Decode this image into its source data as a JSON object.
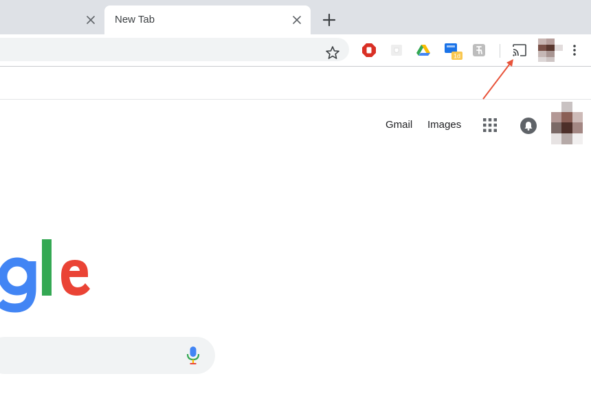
{
  "browser": {
    "active_tab": {
      "title": "New Tab"
    },
    "colors": {
      "tabstrip": "#dee1e6",
      "omnibox": "#f1f3f4",
      "annotation_arrow": "#e8533a"
    }
  },
  "toolbar": {
    "icons": [
      "bookmark-star-icon",
      "adblock-icon",
      "shield-extension-icon",
      "google-drive-icon",
      "extension-badge-icon",
      "extension-grey-icon",
      "cast-icon",
      "profile-avatar",
      "more-vert-icon"
    ],
    "extension_badge": "1d"
  },
  "google": {
    "header_links": {
      "gmail": "Gmail",
      "images": "Images"
    },
    "logo_partial": "gle",
    "logo_colors": {
      "g": "#4285F4",
      "l": "#34A853",
      "e": "#EA4335"
    }
  }
}
